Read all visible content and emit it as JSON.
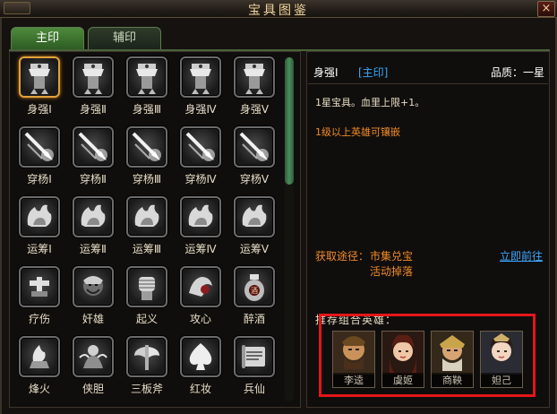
{
  "window": {
    "title": "宝具图鉴",
    "close_glyph": "×"
  },
  "tabs": [
    {
      "label": "主印",
      "active": true
    },
    {
      "label": "辅印",
      "active": false
    }
  ],
  "grid": {
    "selected_index": 0,
    "items": [
      {
        "label": "身强Ⅰ",
        "icon": "armor-icon"
      },
      {
        "label": "身强Ⅱ",
        "icon": "armor-icon"
      },
      {
        "label": "身强Ⅲ",
        "icon": "armor-icon"
      },
      {
        "label": "身强Ⅳ",
        "icon": "armor-icon"
      },
      {
        "label": "身强Ⅴ",
        "icon": "armor-icon"
      },
      {
        "label": "穿杨Ⅰ",
        "icon": "arrow-burst-icon"
      },
      {
        "label": "穿杨Ⅱ",
        "icon": "arrow-burst-icon"
      },
      {
        "label": "穿杨Ⅲ",
        "icon": "arrow-burst-icon"
      },
      {
        "label": "穿杨Ⅳ",
        "icon": "arrow-burst-icon"
      },
      {
        "label": "穿杨Ⅴ",
        "icon": "arrow-burst-icon"
      },
      {
        "label": "运筹Ⅰ",
        "icon": "fist-flame-icon"
      },
      {
        "label": "运筹Ⅱ",
        "icon": "fist-flame-icon"
      },
      {
        "label": "运筹Ⅲ",
        "icon": "fist-flame-icon"
      },
      {
        "label": "运筹Ⅳ",
        "icon": "fist-flame-icon"
      },
      {
        "label": "运筹Ⅴ",
        "icon": "fist-flame-icon"
      },
      {
        "label": "疗伤",
        "icon": "heal-icon"
      },
      {
        "label": "奸雄",
        "icon": "warlord-icon"
      },
      {
        "label": "起义",
        "icon": "raised-fist-icon"
      },
      {
        "label": "攻心",
        "icon": "grasp-icon"
      },
      {
        "label": "醉酒",
        "icon": "wine-jar-icon"
      },
      {
        "label": "烽火",
        "icon": "beacon-fire-icon"
      },
      {
        "label": "侠胆",
        "icon": "spirit-icon"
      },
      {
        "label": "三板斧",
        "icon": "axe-icon"
      },
      {
        "label": "红妆",
        "icon": "spade-icon"
      },
      {
        "label": "兵仙",
        "icon": "scroll-icon"
      }
    ]
  },
  "detail": {
    "name": "身强Ⅰ",
    "slot": "[主印]",
    "quality": "品质：一星",
    "description": "1星宝具。血里上限+1。",
    "requirement": "1级以上英雄可镶嵌",
    "source_label": "获取途径：",
    "sources": [
      "市集兑宝",
      "活动掉落"
    ],
    "goto_label": "立即前往",
    "hero_section_title": "推荐组合英雄：",
    "heroes": [
      {
        "name": "李逵",
        "icon": "hero-portrait-icon"
      },
      {
        "name": "虞姬",
        "icon": "hero-portrait-icon"
      },
      {
        "name": "商鞅",
        "icon": "hero-portrait-icon"
      },
      {
        "name": "妲己",
        "icon": "hero-portrait-icon"
      }
    ]
  },
  "colors": {
    "accent_orange": "#f08a28",
    "link_blue": "#3fa8ff",
    "slot_blue": "#38a8ff",
    "highlight_red": "#e3161a",
    "selected_gold": "#e1a23b",
    "tab_green": "#4f8a3c"
  }
}
